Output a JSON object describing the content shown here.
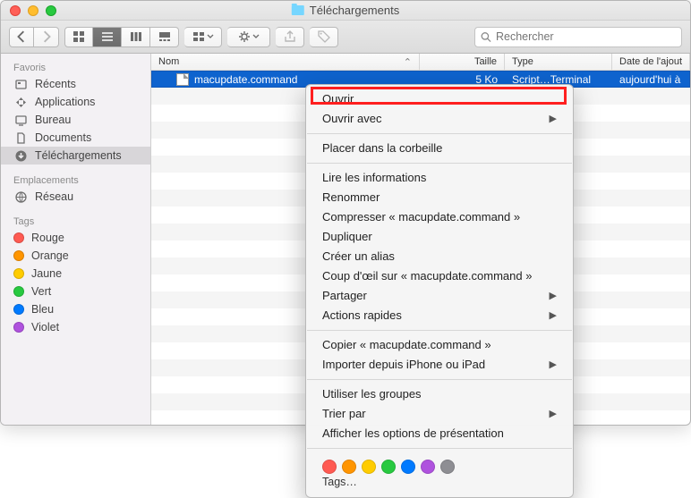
{
  "window": {
    "title": "Téléchargements"
  },
  "search": {
    "placeholder": "Rechercher"
  },
  "sidebar": {
    "sections": [
      {
        "title": "Favoris",
        "items": [
          {
            "label": "Récents",
            "icon": "recents"
          },
          {
            "label": "Applications",
            "icon": "apps"
          },
          {
            "label": "Bureau",
            "icon": "desktop"
          },
          {
            "label": "Documents",
            "icon": "docs"
          },
          {
            "label": "Téléchargements",
            "icon": "downloads",
            "selected": true
          }
        ]
      },
      {
        "title": "Emplacements",
        "items": [
          {
            "label": "Réseau",
            "icon": "network"
          }
        ]
      },
      {
        "title": "Tags",
        "items": [
          {
            "label": "Rouge",
            "color": "#ff5a52"
          },
          {
            "label": "Orange",
            "color": "#ff9500"
          },
          {
            "label": "Jaune",
            "color": "#ffcc00"
          },
          {
            "label": "Vert",
            "color": "#28c940"
          },
          {
            "label": "Bleu",
            "color": "#007aff"
          },
          {
            "label": "Violet",
            "color": "#af52de"
          }
        ]
      }
    ]
  },
  "columns": {
    "name": "Nom",
    "size": "Taille",
    "type": "Type",
    "date": "Date de l'ajout"
  },
  "rows": [
    {
      "name": "macupdate.command",
      "size": "5 Ko",
      "type": "Script…Terminal",
      "date": "aujourd'hui à",
      "selected": true
    }
  ],
  "context_menu": {
    "groups": [
      [
        {
          "label": "Ouvrir",
          "highlighted": true
        },
        {
          "label": "Ouvrir avec",
          "submenu": true
        }
      ],
      [
        {
          "label": "Placer dans la corbeille"
        }
      ],
      [
        {
          "label": "Lire les informations"
        },
        {
          "label": "Renommer"
        },
        {
          "label": "Compresser « macupdate.command »"
        },
        {
          "label": "Dupliquer"
        },
        {
          "label": "Créer un alias"
        },
        {
          "label": "Coup d'œil sur « macupdate.command »"
        },
        {
          "label": "Partager",
          "submenu": true
        },
        {
          "label": "Actions rapides",
          "submenu": true
        }
      ],
      [
        {
          "label": "Copier « macupdate.command »"
        },
        {
          "label": "Importer depuis iPhone ou iPad",
          "submenu": true
        }
      ],
      [
        {
          "label": "Utiliser les groupes"
        },
        {
          "label": "Trier par",
          "submenu": true
        },
        {
          "label": "Afficher les options de présentation"
        }
      ]
    ],
    "tag_colors": [
      "#ff5a52",
      "#ff9500",
      "#ffcc00",
      "#28c940",
      "#007aff",
      "#af52de",
      "#8e8e93"
    ],
    "tags_label": "Tags…"
  }
}
